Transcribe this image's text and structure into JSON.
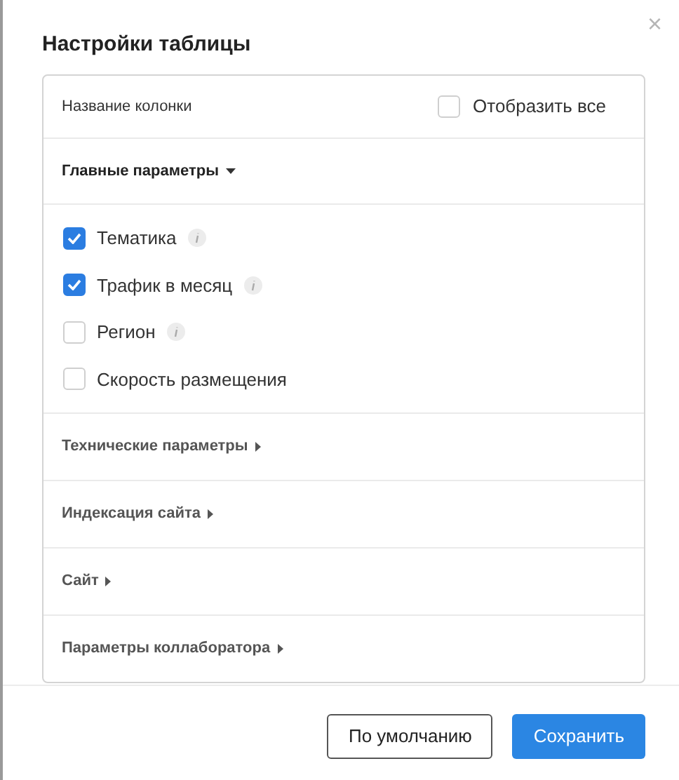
{
  "dialog": {
    "title": "Настройки таблицы",
    "close": "×"
  },
  "header": {
    "column_label": "Название колонки",
    "show_all": {
      "label": "Отобразить все",
      "checked": false
    }
  },
  "sections": [
    {
      "title": "Главные параметры",
      "expanded": true,
      "items": [
        {
          "label": "Тематика",
          "checked": true,
          "info": true
        },
        {
          "label": "Трафик в месяц",
          "checked": true,
          "info": true
        },
        {
          "label": "Регион",
          "checked": false,
          "info": true
        },
        {
          "label": "Скорость размещения",
          "checked": false,
          "info": false
        }
      ]
    },
    {
      "title": "Технические параметры",
      "expanded": false
    },
    {
      "title": "Индексация сайта",
      "expanded": false
    },
    {
      "title": "Сайт",
      "expanded": false
    },
    {
      "title": "Параметры коллаборатора",
      "expanded": false
    }
  ],
  "buttons": [
    {
      "label": "По умолчанию",
      "kind": "secondary"
    },
    {
      "label": "Сохранить",
      "kind": "primary"
    }
  ]
}
